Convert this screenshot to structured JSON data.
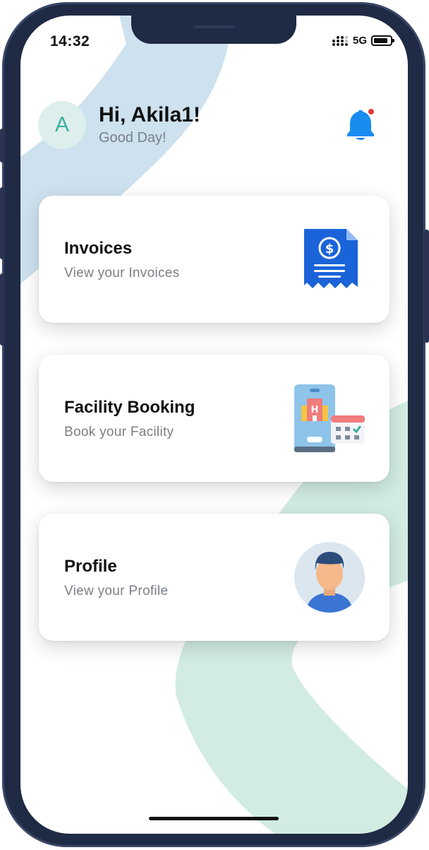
{
  "status_bar": {
    "time": "14:32",
    "network": "5G",
    "battery_level": 0.85
  },
  "header": {
    "avatar_letter": "A",
    "greeting": "Hi, Akila1!",
    "subtitle": "Good Day!"
  },
  "cards": [
    {
      "title": "Invoices",
      "subtitle": "View your Invoices",
      "icon": "invoice-icon"
    },
    {
      "title": "Facility Booking",
      "subtitle": "Book your Facility",
      "icon": "facility-booking-icon"
    },
    {
      "title": "Profile",
      "subtitle": "View your Profile",
      "icon": "profile-icon"
    }
  ],
  "colors": {
    "accent_blue": "#1a8cf0",
    "avatar_teal": "#3eae9d",
    "notification_dot": "#e53935",
    "bg_blue_shape": "#cde1ef",
    "bg_green_shape": "#d2ece1",
    "frame": "#1f2a44"
  }
}
